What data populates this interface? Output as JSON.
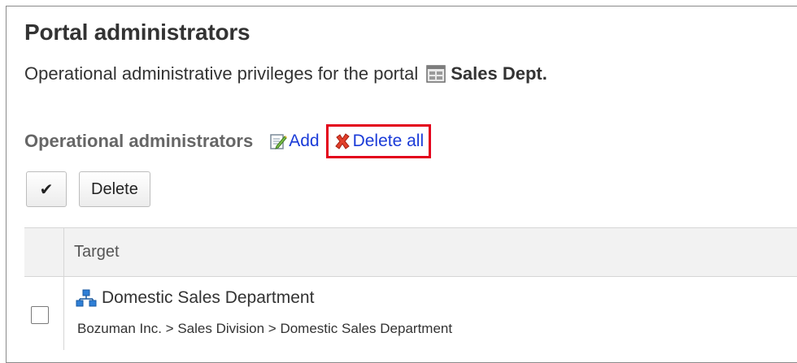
{
  "page": {
    "title": "Portal administrators",
    "description": "Operational administrative privileges for the portal",
    "portal_name": "Sales Dept."
  },
  "section": {
    "title": "Operational administrators",
    "add_label": "Add",
    "delete_all_label": "Delete all"
  },
  "toolbar": {
    "check_label": "✔",
    "delete_label": "Delete"
  },
  "table": {
    "header_target": "Target",
    "rows": [
      {
        "name": "Domestic Sales Department",
        "path": "Bozuman Inc. > Sales Division > Domestic Sales Department"
      }
    ]
  },
  "colors": {
    "link": "#1a3bd8",
    "highlight_border": "#e3001b",
    "header_bg": "#f2f2f2"
  },
  "icons": [
    "portal-icon",
    "add-edit-icon",
    "delete-x-icon",
    "organization-icon"
  ]
}
